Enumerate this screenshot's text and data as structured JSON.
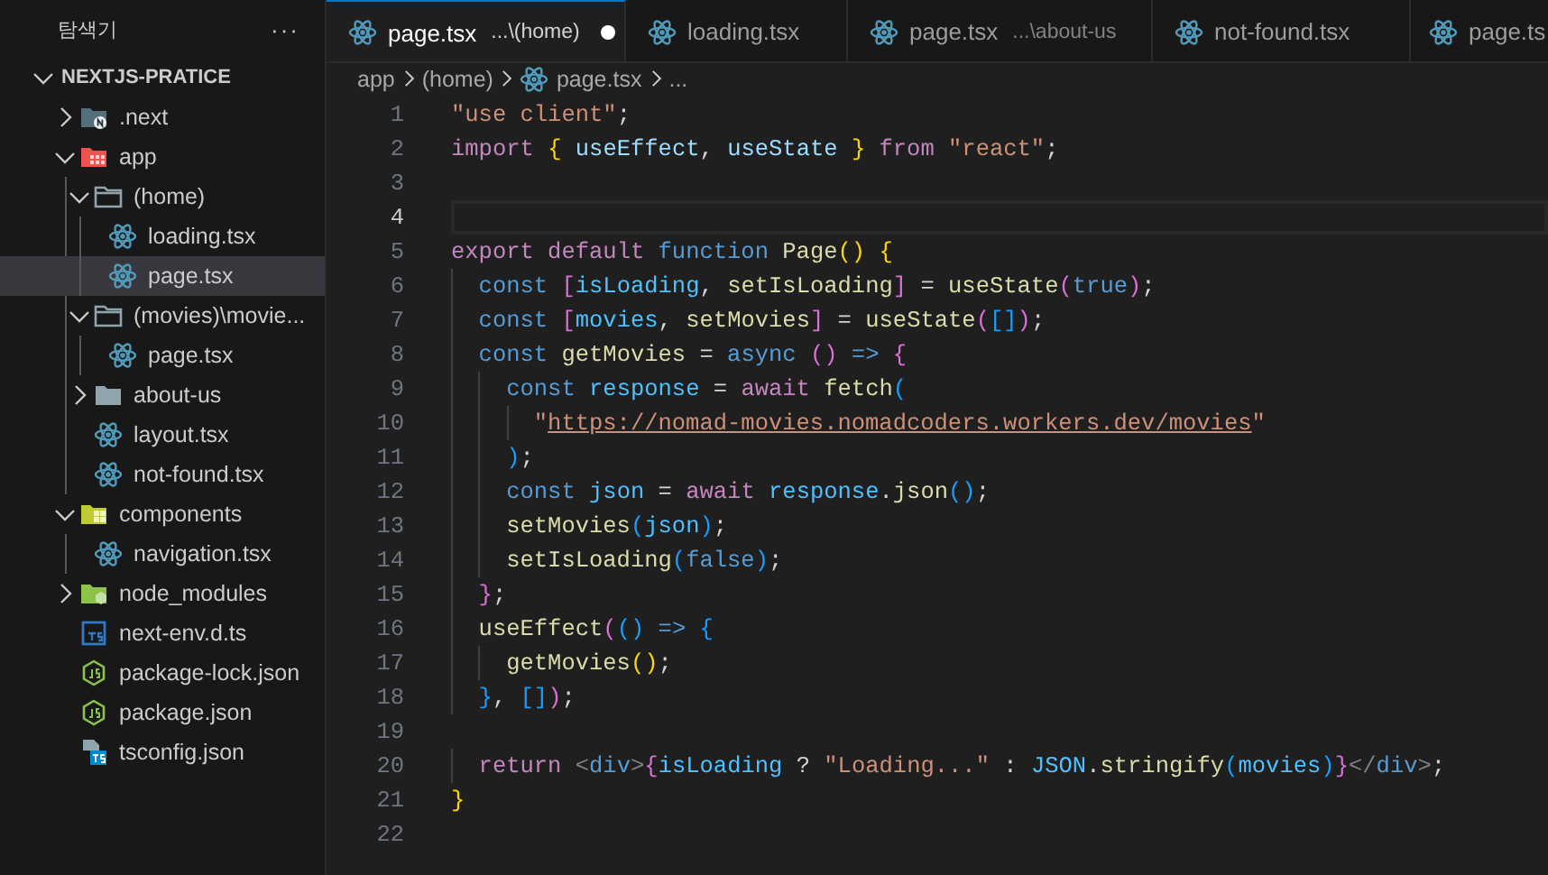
{
  "explorer": {
    "header": "탐색기",
    "more": "···",
    "root": {
      "title": "NEXTJS-PRATICE",
      "expanded": true
    },
    "items": [
      {
        "label": ".next",
        "kind": "next-folder",
        "expanded": false,
        "selected": false
      },
      {
        "label": "app",
        "kind": "app-folder",
        "expanded": true,
        "selected": false,
        "children": [
          {
            "label": "(home)",
            "kind": "folder",
            "expanded": true,
            "selected": false,
            "children": [
              {
                "label": "loading.tsx",
                "kind": "react-file",
                "selected": false
              },
              {
                "label": "page.tsx",
                "kind": "react-file",
                "selected": true
              }
            ]
          },
          {
            "label": "(movies)\\movie...",
            "kind": "folder",
            "expanded": true,
            "selected": false,
            "children": [
              {
                "label": "page.tsx",
                "kind": "react-file",
                "selected": false
              }
            ]
          },
          {
            "label": "about-us",
            "kind": "folder",
            "expanded": false,
            "selected": false
          },
          {
            "label": "layout.tsx",
            "kind": "react-file",
            "selected": false
          },
          {
            "label": "not-found.tsx",
            "kind": "react-file",
            "selected": false
          }
        ]
      },
      {
        "label": "components",
        "kind": "components-folder",
        "expanded": true,
        "selected": false,
        "children": [
          {
            "label": "navigation.tsx",
            "kind": "react-file",
            "selected": false
          }
        ]
      },
      {
        "label": "node_modules",
        "kind": "node-folder",
        "expanded": false,
        "selected": false
      },
      {
        "label": "next-env.d.ts",
        "kind": "ts-file",
        "selected": false
      },
      {
        "label": "package-lock.json",
        "kind": "js-file",
        "selected": false
      },
      {
        "label": "package.json",
        "kind": "js-file",
        "selected": false
      },
      {
        "label": "tsconfig.json",
        "kind": "tsconfig-file",
        "selected": false
      }
    ]
  },
  "tabs": [
    {
      "name": "page.tsx",
      "path": "...\\(home)",
      "selected": true,
      "modified": true
    },
    {
      "name": "loading.tsx",
      "selected": false,
      "modified": false
    },
    {
      "name": "page.tsx",
      "path": "...\\about-us",
      "selected": false,
      "modified": false
    },
    {
      "name": "not-found.tsx",
      "selected": false,
      "modified": false
    },
    {
      "name": "page.ts",
      "selected": false,
      "modified": false
    }
  ],
  "breadcrumb": [
    {
      "label": "app",
      "kind": "folder"
    },
    {
      "label": "(home)",
      "kind": "folder"
    },
    {
      "label": "page.tsx",
      "kind": "react-file"
    },
    {
      "label": "...",
      "kind": "more"
    }
  ],
  "code": [
    {
      "number": "1",
      "current": false,
      "tokens": [
        {
          "text": "\"use client\"",
          "kind": "string"
        },
        {
          "text": ";",
          "kind": "plain"
        }
      ]
    },
    {
      "number": "2",
      "current": false,
      "tokens": [
        {
          "text": "import",
          "kind": "control"
        },
        {
          "text": " {",
          "kind": "bracket1"
        },
        {
          "text": " useEffect",
          "kind": "variable"
        },
        {
          "text": ", ",
          "kind": "plain"
        },
        {
          "text": "useState ",
          "kind": "variable"
        },
        {
          "text": "}",
          "kind": "bracket1"
        },
        {
          "text": " from",
          "kind": "control"
        },
        {
          "text": " \"react\"",
          "kind": "string"
        },
        {
          "text": ";",
          "kind": "plain"
        }
      ]
    },
    {
      "number": "3",
      "current": false
    },
    {
      "number": "4",
      "current": true
    },
    {
      "number": "5",
      "current": false,
      "tokens": [
        {
          "text": "export default",
          "kind": "control"
        },
        {
          "text": " function",
          "kind": "keyword"
        },
        {
          "text": " Page",
          "kind": "function"
        },
        {
          "text": "()",
          "kind": "bracket1"
        },
        {
          "text": " {",
          "kind": "bracket1"
        }
      ]
    },
    {
      "number": "6",
      "current": false,
      "tokens": [
        {
          "text": "  const",
          "kind": "keyword"
        },
        {
          "text": " [",
          "kind": "bracket2"
        },
        {
          "text": "isLoading",
          "kind": "constant"
        },
        {
          "text": ", ",
          "kind": "plain"
        },
        {
          "text": "setIsLoading",
          "kind": "function"
        },
        {
          "text": "]",
          "kind": "bracket2"
        },
        {
          "text": " = ",
          "kind": "plain"
        },
        {
          "text": "useState",
          "kind": "function"
        },
        {
          "text": "(",
          "kind": "bracket2"
        },
        {
          "text": "true",
          "kind": "keyword"
        },
        {
          "text": ")",
          "kind": "bracket2"
        },
        {
          "text": ";",
          "kind": "plain"
        }
      ]
    },
    {
      "number": "7",
      "current": false,
      "tokens": [
        {
          "text": "  const",
          "kind": "keyword"
        },
        {
          "text": " [",
          "kind": "bracket2"
        },
        {
          "text": "movies",
          "kind": "constant"
        },
        {
          "text": ", ",
          "kind": "plain"
        },
        {
          "text": "setMovies",
          "kind": "function"
        },
        {
          "text": "]",
          "kind": "bracket2"
        },
        {
          "text": " = ",
          "kind": "plain"
        },
        {
          "text": "useState",
          "kind": "function"
        },
        {
          "text": "(",
          "kind": "bracket2"
        },
        {
          "text": "[]",
          "kind": "bracket3"
        },
        {
          "text": ")",
          "kind": "bracket2"
        },
        {
          "text": ";",
          "kind": "plain"
        }
      ]
    },
    {
      "number": "8",
      "current": false,
      "tokens": [
        {
          "text": "  const",
          "kind": "keyword"
        },
        {
          "text": " getMovies",
          "kind": "function"
        },
        {
          "text": " = ",
          "kind": "plain"
        },
        {
          "text": "async",
          "kind": "keyword"
        },
        {
          "text": " ()",
          "kind": "bracket2"
        },
        {
          "text": " =>",
          "kind": "keyword"
        },
        {
          "text": " {",
          "kind": "bracket2"
        }
      ]
    },
    {
      "number": "9",
      "current": false,
      "tokens": [
        {
          "text": "    const",
          "kind": "keyword"
        },
        {
          "text": " response",
          "kind": "constant"
        },
        {
          "text": " = ",
          "kind": "plain"
        },
        {
          "text": "await",
          "kind": "control"
        },
        {
          "text": " fetch",
          "kind": "function"
        },
        {
          "text": "(",
          "kind": "bracket3"
        }
      ]
    },
    {
      "number": "10",
      "current": false,
      "tokens": [
        {
          "text": "      \"",
          "kind": "string"
        },
        {
          "text": "https://nomad-movies.nomadcoders.workers.dev/movies",
          "kind": "link"
        },
        {
          "text": "\"",
          "kind": "string"
        }
      ]
    },
    {
      "number": "11",
      "current": false,
      "tokens": [
        {
          "text": "    )",
          "kind": "bracket3"
        },
        {
          "text": ";",
          "kind": "plain"
        }
      ]
    },
    {
      "number": "12",
      "current": false,
      "tokens": [
        {
          "text": "    const",
          "kind": "keyword"
        },
        {
          "text": " json",
          "kind": "constant"
        },
        {
          "text": " = ",
          "kind": "plain"
        },
        {
          "text": "await",
          "kind": "control"
        },
        {
          "text": " response",
          "kind": "constant"
        },
        {
          "text": ".",
          "kind": "plain"
        },
        {
          "text": "json",
          "kind": "function"
        },
        {
          "text": "()",
          "kind": "bracket3"
        },
        {
          "text": ";",
          "kind": "plain"
        }
      ]
    },
    {
      "number": "13",
      "current": false,
      "tokens": [
        {
          "text": "    setMovies",
          "kind": "function"
        },
        {
          "text": "(",
          "kind": "bracket3"
        },
        {
          "text": "json",
          "kind": "constant"
        },
        {
          "text": ")",
          "kind": "bracket3"
        },
        {
          "text": ";",
          "kind": "plain"
        }
      ]
    },
    {
      "number": "14",
      "current": false,
      "tokens": [
        {
          "text": "    setIsLoading",
          "kind": "function"
        },
        {
          "text": "(",
          "kind": "bracket3"
        },
        {
          "text": "false",
          "kind": "keyword"
        },
        {
          "text": ")",
          "kind": "bracket3"
        },
        {
          "text": ";",
          "kind": "plain"
        }
      ]
    },
    {
      "number": "15",
      "current": false,
      "tokens": [
        {
          "text": "  }",
          "kind": "bracket2"
        },
        {
          "text": ";",
          "kind": "plain"
        }
      ]
    },
    {
      "number": "16",
      "current": false,
      "tokens": [
        {
          "text": "  useEffect",
          "kind": "function"
        },
        {
          "text": "(",
          "kind": "bracket2"
        },
        {
          "text": "()",
          "kind": "bracket3"
        },
        {
          "text": " =>",
          "kind": "keyword"
        },
        {
          "text": " {",
          "kind": "bracket3"
        }
      ]
    },
    {
      "number": "17",
      "current": false,
      "tokens": [
        {
          "text": "    getMovies",
          "kind": "function"
        },
        {
          "text": "()",
          "kind": "bracket1"
        },
        {
          "text": ";",
          "kind": "plain"
        }
      ]
    },
    {
      "number": "18",
      "current": false,
      "tokens": [
        {
          "text": "  }",
          "kind": "bracket3"
        },
        {
          "text": ", ",
          "kind": "plain"
        },
        {
          "text": "[]",
          "kind": "bracket3"
        },
        {
          "text": ")",
          "kind": "bracket2"
        },
        {
          "text": ";",
          "kind": "plain"
        }
      ]
    },
    {
      "number": "19",
      "current": false
    },
    {
      "number": "20",
      "current": false,
      "tokens": [
        {
          "text": "  return",
          "kind": "control"
        },
        {
          "text": " <",
          "kind": "punct"
        },
        {
          "text": "div",
          "kind": "tag"
        },
        {
          "text": ">",
          "kind": "punct"
        },
        {
          "text": "{",
          "kind": "bracket2"
        },
        {
          "text": "isLoading",
          "kind": "constant"
        },
        {
          "text": " ? ",
          "kind": "plain"
        },
        {
          "text": "\"Loading...\"",
          "kind": "string"
        },
        {
          "text": " : ",
          "kind": "plain"
        },
        {
          "text": "JSON",
          "kind": "constant"
        },
        {
          "text": ".",
          "kind": "plain"
        },
        {
          "text": "stringify",
          "kind": "function"
        },
        {
          "text": "(",
          "kind": "bracket3"
        },
        {
          "text": "movies",
          "kind": "constant"
        },
        {
          "text": ")",
          "kind": "bracket3"
        },
        {
          "text": "}",
          "kind": "bracket2"
        },
        {
          "text": "</",
          "kind": "punct"
        },
        {
          "text": "div",
          "kind": "tag"
        },
        {
          "text": ">",
          "kind": "punct"
        },
        {
          "text": ";",
          "kind": "plain"
        }
      ]
    },
    {
      "number": "21",
      "current": false,
      "tokens": [
        {
          "text": "}",
          "kind": "bracket1"
        }
      ]
    },
    {
      "number": "22",
      "current": false
    }
  ]
}
